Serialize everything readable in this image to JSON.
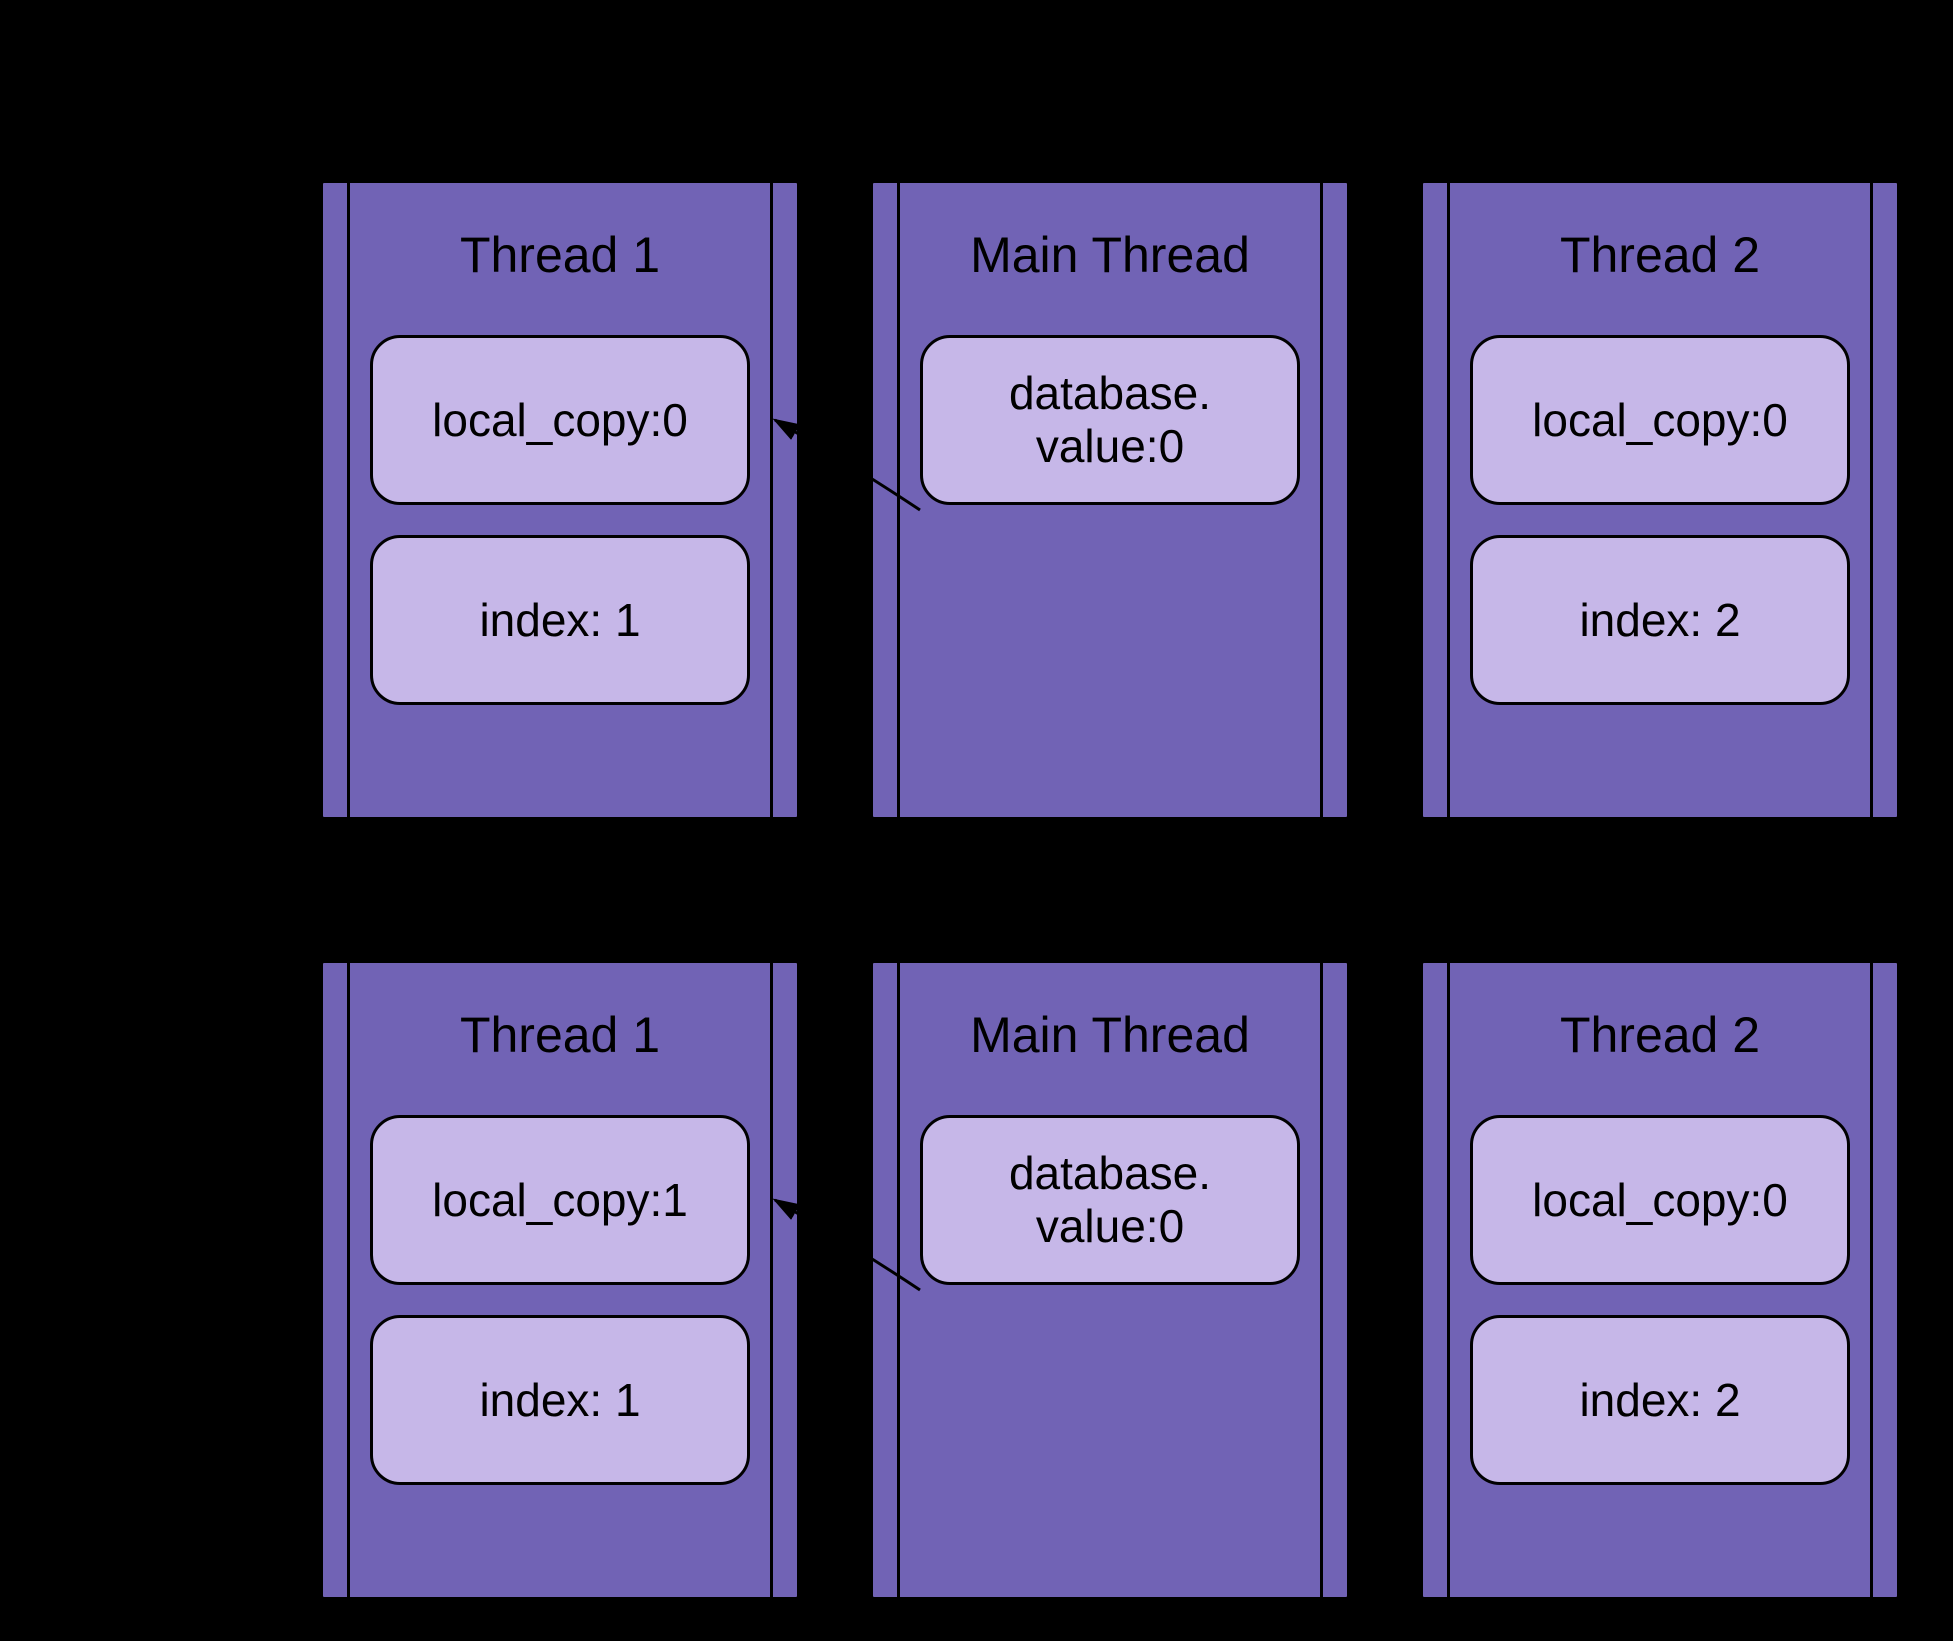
{
  "rows": [
    {
      "thread1": {
        "title": "Thread 1",
        "box1": "local_copy:0",
        "box2": "index: 1"
      },
      "main": {
        "title": "Main Thread",
        "box1": "database.\nvalue:0"
      },
      "thread2": {
        "title": "Thread 2",
        "box1": "local_copy:0",
        "box2": "index: 2"
      }
    },
    {
      "thread1": {
        "title": "Thread 1",
        "box1": "local_copy:1",
        "box2": "index: 1"
      },
      "main": {
        "title": "Main Thread",
        "box1": "database.\nvalue:0"
      },
      "thread2": {
        "title": "Thread 2",
        "box1": "local_copy:0",
        "box2": "index: 2"
      }
    }
  ]
}
